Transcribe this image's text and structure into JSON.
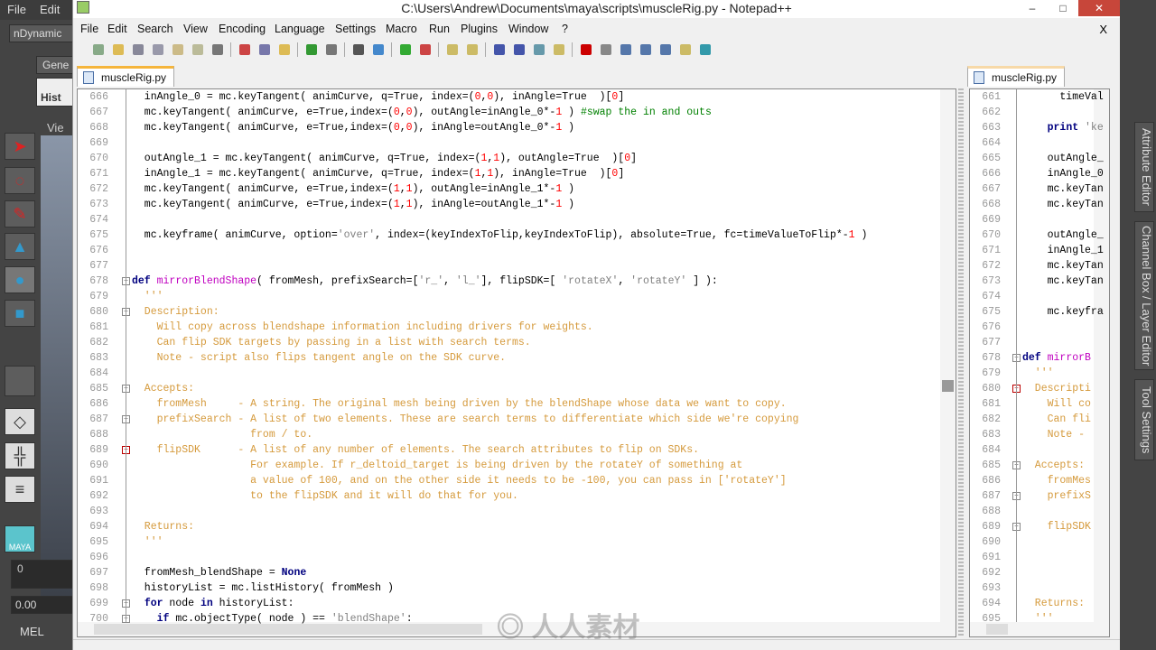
{
  "maya_left": {
    "menu": [
      "File",
      "Edit"
    ],
    "shelf_dropdown": "nDynamic",
    "tab_general": "Gene",
    "hist_button": "Hist",
    "view_label": "Vie",
    "frame_field": "0",
    "time_field": "0.00",
    "script_lang": "MEL",
    "logo": "MAYA"
  },
  "window": {
    "title": "C:\\Users\\Andrew\\Documents\\maya\\scripts\\muscleRig.py - Notepad++",
    "minimize": "–",
    "maximize": "□",
    "close": "✕",
    "close_doc": "X"
  },
  "menu": [
    "File",
    "Edit",
    "Search",
    "View",
    "Encoding",
    "Language",
    "Settings",
    "Macro",
    "Run",
    "Plugins",
    "Window",
    "?"
  ],
  "toolbar": [
    "new-file",
    "open-file",
    "save",
    "save-all",
    "close",
    "close-all",
    "print",
    "cut",
    "copy",
    "paste",
    "undo",
    "redo",
    "find",
    "replace",
    "zoom-in",
    "zoom-out",
    "sync-vertical",
    "sync-horizontal",
    "word-wrap",
    "show-all-chars",
    "indent-guide",
    "doc-map",
    "record-macro",
    "stop-macro",
    "play-macro",
    "run-macro-multiple",
    "save-macro",
    "monitor-file",
    "spell-check"
  ],
  "tabs": {
    "left": "muscleRig.py",
    "right": "muscleRig.py"
  },
  "main_lines": [
    {
      "n": "666",
      "tokens": [
        [
          "  inAngle_0 = mc.keyTangent( animCurve, q=True, index=(",
          "t"
        ],
        [
          "0",
          "n"
        ],
        [
          ",",
          "t"
        ],
        [
          "0",
          "n"
        ],
        [
          "), inAngle=True  )[",
          "t"
        ],
        [
          "0",
          "n"
        ],
        [
          "]",
          "t"
        ]
      ]
    },
    {
      "n": "667",
      "tokens": [
        [
          "  mc.keyTangent( animCurve, e=True,index=(",
          "t"
        ],
        [
          "0",
          "n"
        ],
        [
          ",",
          "t"
        ],
        [
          "0",
          "n"
        ],
        [
          "), outAngle=inAngle_0*-",
          "t"
        ],
        [
          "1",
          "n"
        ],
        [
          " ) ",
          "t"
        ],
        [
          "#swap the in and outs",
          "c"
        ]
      ]
    },
    {
      "n": "668",
      "tokens": [
        [
          "  mc.keyTangent( animCurve, e=True,index=(",
          "t"
        ],
        [
          "0",
          "n"
        ],
        [
          ",",
          "t"
        ],
        [
          "0",
          "n"
        ],
        [
          "), inAngle=outAngle_0*-",
          "t"
        ],
        [
          "1",
          "n"
        ],
        [
          " )",
          "t"
        ]
      ]
    },
    {
      "n": "669",
      "tokens": []
    },
    {
      "n": "670",
      "tokens": [
        [
          "  outAngle_1 = mc.keyTangent( animCurve, q=True, index=(",
          "t"
        ],
        [
          "1",
          "n"
        ],
        [
          ",",
          "t"
        ],
        [
          "1",
          "n"
        ],
        [
          "), outAngle=True  )[",
          "t"
        ],
        [
          "0",
          "n"
        ],
        [
          "]",
          "t"
        ]
      ]
    },
    {
      "n": "671",
      "tokens": [
        [
          "  inAngle_1 = mc.keyTangent( animCurve, q=True, index=(",
          "t"
        ],
        [
          "1",
          "n"
        ],
        [
          ",",
          "t"
        ],
        [
          "1",
          "n"
        ],
        [
          "), inAngle=True  )[",
          "t"
        ],
        [
          "0",
          "n"
        ],
        [
          "]",
          "t"
        ]
      ]
    },
    {
      "n": "672",
      "tokens": [
        [
          "  mc.keyTangent( animCurve, e=True,index=(",
          "t"
        ],
        [
          "1",
          "n"
        ],
        [
          ",",
          "t"
        ],
        [
          "1",
          "n"
        ],
        [
          "), outAngle=inAngle_1*-",
          "t"
        ],
        [
          "1",
          "n"
        ],
        [
          " )",
          "t"
        ]
      ]
    },
    {
      "n": "673",
      "tokens": [
        [
          "  mc.keyTangent( animCurve, e=True,index=(",
          "t"
        ],
        [
          "1",
          "n"
        ],
        [
          ",",
          "t"
        ],
        [
          "1",
          "n"
        ],
        [
          "), inAngle=outAngle_1*-",
          "t"
        ],
        [
          "1",
          "n"
        ],
        [
          " )",
          "t"
        ]
      ]
    },
    {
      "n": "674",
      "tokens": []
    },
    {
      "n": "675",
      "tokens": [
        [
          "  mc.keyframe( animCurve, option=",
          "t"
        ],
        [
          "'over'",
          "s"
        ],
        [
          ", index=(keyIndexToFlip,keyIndexToFlip), absolute=True, fc=timeValueToFlip*-",
          "t"
        ],
        [
          "1",
          "n"
        ],
        [
          " )",
          "t"
        ]
      ]
    },
    {
      "n": "676",
      "tokens": []
    },
    {
      "n": "677",
      "tokens": []
    },
    {
      "n": "678",
      "tokens": [
        [
          "def",
          "k"
        ],
        [
          " ",
          "t"
        ],
        [
          "mirrorBlendShape",
          "f"
        ],
        [
          "( fromMesh, prefixSearch=[",
          "t"
        ],
        [
          "'r_'",
          "s"
        ],
        [
          ", ",
          "t"
        ],
        [
          "'l_'",
          "s"
        ],
        [
          "], flipSDK=[ ",
          "t"
        ],
        [
          "'rotateX'",
          "s"
        ],
        [
          ", ",
          "t"
        ],
        [
          "'rotateY'",
          "s"
        ],
        [
          " ] ):",
          "t"
        ]
      ]
    },
    {
      "n": "679",
      "tokens": [
        [
          "  '''",
          "d"
        ]
      ]
    },
    {
      "n": "680",
      "tokens": [
        [
          "  Description:",
          "d"
        ]
      ]
    },
    {
      "n": "681",
      "tokens": [
        [
          "    Will copy across blendshape information including drivers for weights.",
          "d"
        ]
      ]
    },
    {
      "n": "682",
      "tokens": [
        [
          "    Can flip SDK targets by passing in a list with search terms.",
          "d"
        ]
      ]
    },
    {
      "n": "683",
      "tokens": [
        [
          "    Note - script also flips tangent angle on the SDK curve.",
          "d"
        ]
      ]
    },
    {
      "n": "684",
      "tokens": []
    },
    {
      "n": "685",
      "tokens": [
        [
          "  Accepts:",
          "d"
        ]
      ]
    },
    {
      "n": "686",
      "tokens": [
        [
          "    fromMesh     - A string. The original mesh being driven by the blendShape whose data we want to copy.",
          "d"
        ]
      ]
    },
    {
      "n": "687",
      "tokens": [
        [
          "    prefixSearch - A list of two elements. These are search terms to differentiate which side we're copying",
          "d"
        ]
      ]
    },
    {
      "n": "688",
      "tokens": [
        [
          "                   from / to.",
          "d"
        ]
      ]
    },
    {
      "n": "689",
      "tokens": [
        [
          "    flipSDK      - A list of any number of elements. The search attributes to flip on SDKs.",
          "d"
        ]
      ]
    },
    {
      "n": "690",
      "tokens": [
        [
          "                   For example. If r_deltoid_target is being driven by the rotateY of something at",
          "d"
        ]
      ]
    },
    {
      "n": "691",
      "tokens": [
        [
          "                   a value of 100, and on the other side it needs to be -100, you can pass in ['rotateY']",
          "d"
        ]
      ]
    },
    {
      "n": "692",
      "tokens": [
        [
          "                   to the flipSDK and it will do that for you.",
          "d"
        ]
      ]
    },
    {
      "n": "693",
      "tokens": []
    },
    {
      "n": "694",
      "tokens": [
        [
          "  Returns:",
          "d"
        ]
      ]
    },
    {
      "n": "695",
      "tokens": [
        [
          "  '''",
          "d"
        ]
      ]
    },
    {
      "n": "696",
      "tokens": []
    },
    {
      "n": "697",
      "tokens": [
        [
          "  fromMesh_blendShape = ",
          "t"
        ],
        [
          "None",
          "k"
        ]
      ]
    },
    {
      "n": "698",
      "tokens": [
        [
          "  historyList = mc.listHistory( fromMesh )",
          "t"
        ]
      ]
    },
    {
      "n": "699",
      "tokens": [
        [
          "  ",
          "t"
        ],
        [
          "for",
          "k"
        ],
        [
          " node ",
          "t"
        ],
        [
          "in",
          "k"
        ],
        [
          " historyList:",
          "t"
        ]
      ]
    },
    {
      "n": "700",
      "tokens": [
        [
          "    ",
          "t"
        ],
        [
          "if",
          "k"
        ],
        [
          " mc.objectType( node ) == ",
          "t"
        ],
        [
          "'blendShape'",
          "s"
        ],
        [
          ":",
          "t"
        ]
      ]
    }
  ],
  "right_lines": [
    {
      "n": "661",
      "tokens": [
        [
          "      timeVal",
          "t"
        ]
      ]
    },
    {
      "n": "662",
      "tokens": []
    },
    {
      "n": "663",
      "tokens": [
        [
          "    ",
          "t"
        ],
        [
          "print",
          "k"
        ],
        [
          " ",
          "t"
        ],
        [
          "'ke",
          "s"
        ]
      ]
    },
    {
      "n": "664",
      "tokens": []
    },
    {
      "n": "665",
      "tokens": [
        [
          "    outAngle_",
          "t"
        ]
      ]
    },
    {
      "n": "666",
      "tokens": [
        [
          "    inAngle_0",
          "t"
        ]
      ]
    },
    {
      "n": "667",
      "tokens": [
        [
          "    mc.keyTan",
          "t"
        ]
      ]
    },
    {
      "n": "668",
      "tokens": [
        [
          "    mc.keyTan",
          "t"
        ]
      ]
    },
    {
      "n": "669",
      "tokens": []
    },
    {
      "n": "670",
      "tokens": [
        [
          "    outAngle_",
          "t"
        ]
      ]
    },
    {
      "n": "671",
      "tokens": [
        [
          "    inAngle_1",
          "t"
        ]
      ]
    },
    {
      "n": "672",
      "tokens": [
        [
          "    mc.keyTan",
          "t"
        ]
      ]
    },
    {
      "n": "673",
      "tokens": [
        [
          "    mc.keyTan",
          "t"
        ]
      ]
    },
    {
      "n": "674",
      "tokens": []
    },
    {
      "n": "675",
      "tokens": [
        [
          "    mc.keyfra",
          "t"
        ]
      ]
    },
    {
      "n": "676",
      "tokens": []
    },
    {
      "n": "677",
      "tokens": []
    },
    {
      "n": "678",
      "tokens": [
        [
          "def",
          "k"
        ],
        [
          " ",
          "t"
        ],
        [
          "mirrorB",
          "f"
        ]
      ]
    },
    {
      "n": "679",
      "tokens": [
        [
          "  '''",
          "d"
        ]
      ]
    },
    {
      "n": "680",
      "tokens": [
        [
          "  Descripti",
          "d"
        ]
      ]
    },
    {
      "n": "681",
      "tokens": [
        [
          "    Will co",
          "d"
        ]
      ]
    },
    {
      "n": "682",
      "tokens": [
        [
          "    Can fli",
          "d"
        ]
      ]
    },
    {
      "n": "683",
      "tokens": [
        [
          "    Note -",
          "d"
        ]
      ]
    },
    {
      "n": "684",
      "tokens": []
    },
    {
      "n": "685",
      "tokens": [
        [
          "  Accepts:",
          "d"
        ]
      ]
    },
    {
      "n": "686",
      "tokens": [
        [
          "    fromMes",
          "d"
        ]
      ]
    },
    {
      "n": "687",
      "tokens": [
        [
          "    prefixS",
          "d"
        ]
      ]
    },
    {
      "n": "688",
      "tokens": []
    },
    {
      "n": "689",
      "tokens": [
        [
          "    flipSDK",
          "d"
        ]
      ]
    },
    {
      "n": "690",
      "tokens": []
    },
    {
      "n": "691",
      "tokens": []
    },
    {
      "n": "692",
      "tokens": []
    },
    {
      "n": "693",
      "tokens": []
    },
    {
      "n": "694",
      "tokens": [
        [
          "  Returns:",
          "d"
        ]
      ]
    },
    {
      "n": "695",
      "tokens": [
        [
          "  '''",
          "d"
        ]
      ]
    }
  ],
  "maya_right": {
    "tabs": [
      "Attribute Editor",
      "Channel Box / Layer Editor",
      "Tool Settings"
    ]
  },
  "watermark": "人人素材",
  "colors": {
    "keyword": "#00007f",
    "function": "#c000c0",
    "string": "#808080",
    "docstring": "#d59a3c",
    "number": "#ff0000",
    "comment": "#008000",
    "tab_accent": "#f5b53c"
  }
}
